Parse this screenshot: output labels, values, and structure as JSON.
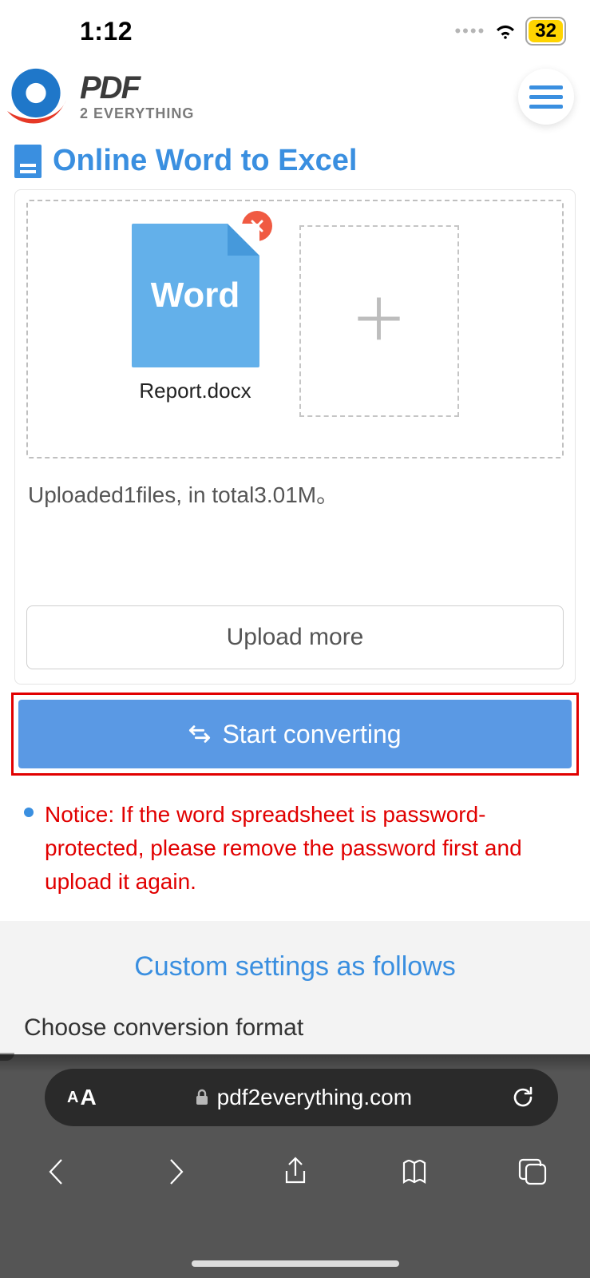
{
  "status": {
    "time": "1:12",
    "battery": "32"
  },
  "brand": {
    "main": "PDF",
    "sub": "2 EVERYTHING"
  },
  "page": {
    "title": "Online Word to Excel"
  },
  "upload": {
    "file": {
      "thumb_label": "Word",
      "name": "Report.docx"
    },
    "status": "Uploaded1files, in total3.01M。",
    "more_label": "Upload more",
    "convert_label": "Start converting"
  },
  "notice": "Notice: If the word spreadsheet is password-protected, please remove the password first and upload it again.",
  "settings": {
    "title": "Custom settings as follows",
    "format_label": "Choose conversion format"
  },
  "browser": {
    "aa": "A",
    "domain": "pdf2everything.com"
  }
}
